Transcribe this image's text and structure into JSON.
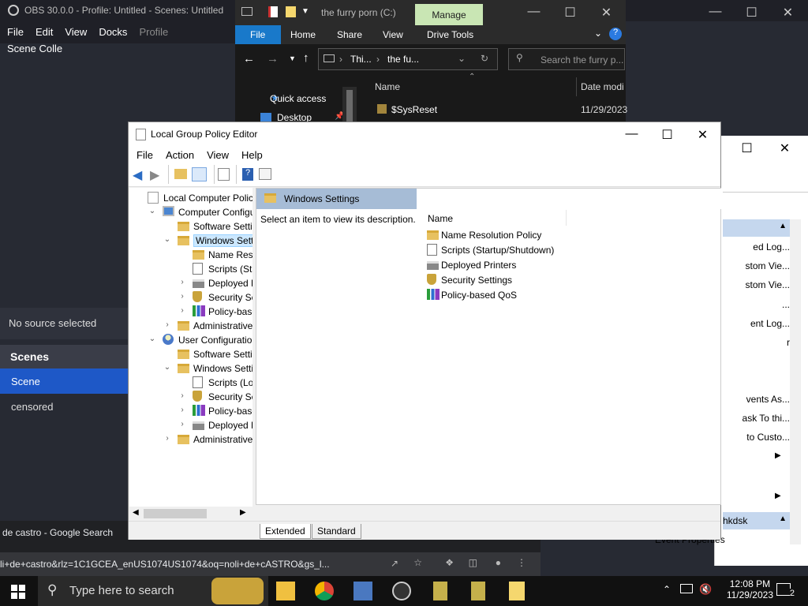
{
  "obs": {
    "title": "OBS 30.0.0 - Profile: Untitled - Scenes: Untitled",
    "menu": [
      "File",
      "Edit",
      "View",
      "Docks",
      "Profile",
      "Scene Colle"
    ],
    "no_source": "No source selected",
    "scenes_header": "Scenes",
    "scenes": [
      "Scene",
      "censored"
    ]
  },
  "explorer": {
    "title": "the furry porn (C:)",
    "manage": "Manage",
    "ribbon_tabs": [
      "File",
      "Home",
      "Share",
      "View",
      "Drive Tools"
    ],
    "address": [
      "Thi...",
      "the fu..."
    ],
    "search_placeholder": "Search the furry p...",
    "col_name": "Name",
    "col_date": "Date modi",
    "nav": [
      "Quick access",
      "Desktop"
    ],
    "rows": [
      {
        "name": "$SysReset",
        "date": "11/29/2023"
      }
    ]
  },
  "gpe": {
    "title": "Local Group Policy Editor",
    "menu": [
      "File",
      "Action",
      "View",
      "Help"
    ],
    "tree": [
      {
        "label": "Local Computer Policy",
        "indent": 0,
        "icon": "policy-icon",
        "toggle": ""
      },
      {
        "label": "Computer Configura",
        "indent": 1,
        "icon": "computer-icon",
        "toggle": "v"
      },
      {
        "label": "Software Settings",
        "indent": 2,
        "icon": "folder-icon",
        "toggle": ""
      },
      {
        "label": "Windows Setting",
        "indent": 2,
        "icon": "folder-icon",
        "toggle": "v",
        "selected": true
      },
      {
        "label": "Name Resolu",
        "indent": 3,
        "icon": "folder-icon",
        "toggle": ""
      },
      {
        "label": "Scripts (Startu",
        "indent": 3,
        "icon": "script-icon",
        "toggle": ""
      },
      {
        "label": "Deployed Prir",
        "indent": 3,
        "icon": "printer-icon",
        "toggle": ">"
      },
      {
        "label": "Security Settir",
        "indent": 3,
        "icon": "security-icon",
        "toggle": ">"
      },
      {
        "label": "Policy-based",
        "indent": 3,
        "icon": "qos-icon",
        "toggle": ">"
      },
      {
        "label": "Administrative Te",
        "indent": 2,
        "icon": "folder-icon",
        "toggle": ">"
      },
      {
        "label": "User Configuration",
        "indent": 1,
        "icon": "user-icon",
        "toggle": "v"
      },
      {
        "label": "Software Settings",
        "indent": 2,
        "icon": "folder-icon",
        "toggle": ""
      },
      {
        "label": "Windows Setting",
        "indent": 2,
        "icon": "folder-icon",
        "toggle": "v"
      },
      {
        "label": "Scripts (Logor",
        "indent": 3,
        "icon": "script-icon",
        "toggle": ""
      },
      {
        "label": "Security Settir",
        "indent": 3,
        "icon": "security-icon",
        "toggle": ">"
      },
      {
        "label": "Policy-based",
        "indent": 3,
        "icon": "qos-icon",
        "toggle": ">"
      },
      {
        "label": "Deployed Prir",
        "indent": 3,
        "icon": "printer-icon",
        "toggle": ">"
      },
      {
        "label": "Administrative Te",
        "indent": 2,
        "icon": "folder-icon",
        "toggle": ">"
      }
    ],
    "band_title": "Windows Settings",
    "description": "Select an item to view its description.",
    "list_header": "Name",
    "items": [
      {
        "label": "Name Resolution Policy",
        "icon": "folder-icon"
      },
      {
        "label": "Scripts (Startup/Shutdown)",
        "icon": "script-icon"
      },
      {
        "label": "Deployed Printers",
        "icon": "printer-icon"
      },
      {
        "label": "Security Settings",
        "icon": "security-icon"
      },
      {
        "label": "Policy-based QoS",
        "icon": "qos-icon"
      }
    ],
    "tabs": [
      "Extended",
      "Standard"
    ]
  },
  "bgwindow": {
    "items": [
      "ed Log...",
      "stom Vie...",
      "stom Vie...",
      "...",
      "ent Log...",
      "r",
      "vents As...",
      "ask To thi...",
      "to Custo...",
      "hkdsk",
      "Event Properties"
    ]
  },
  "chrome": {
    "tab_title": "de castro - Google Search",
    "url": "li+de+castro&rlz=1C1GCEA_enUS1074US1074&oq=noli+de+cASTRO&gs_l..."
  },
  "taskbar": {
    "search_placeholder": "Type here to search",
    "time": "12:08 PM",
    "date": "11/29/2023",
    "notifications": "2"
  }
}
